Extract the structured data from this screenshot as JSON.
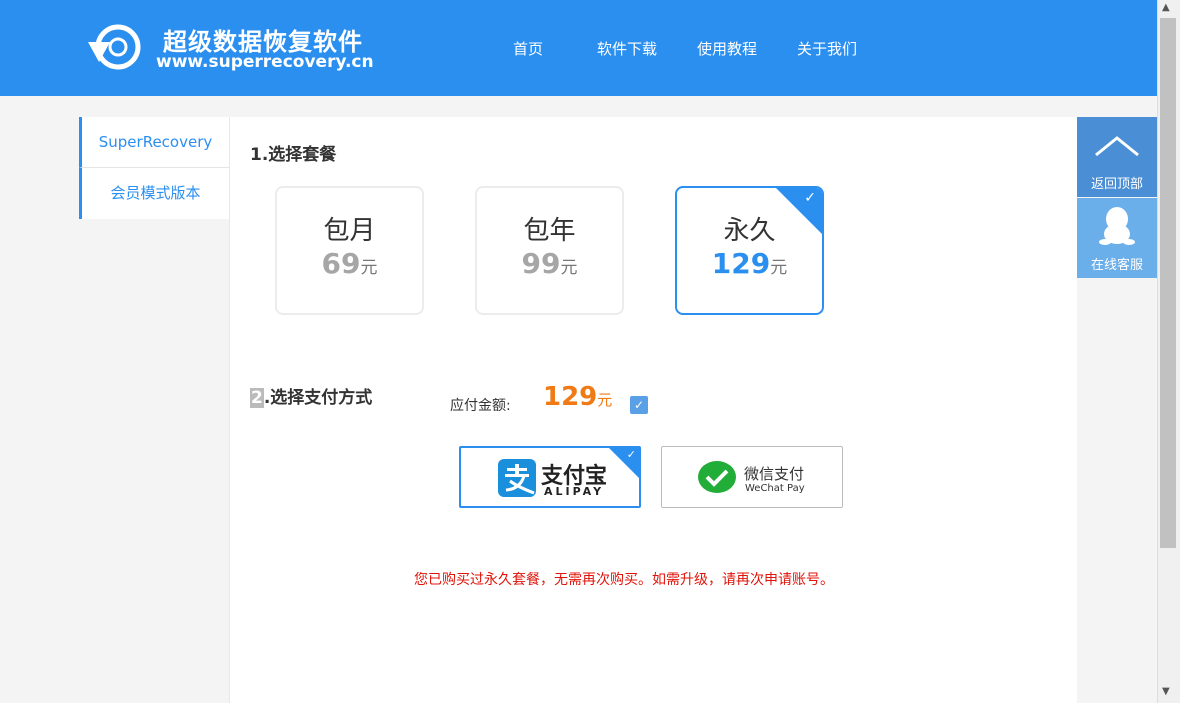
{
  "header": {
    "title": "超级数据恢复软件",
    "url": "www.superrecovery.cn",
    "nav": [
      "首页",
      "软件下载",
      "使用教程",
      "关于我们"
    ]
  },
  "sidebar": {
    "items": [
      "SuperRecovery",
      "会员模式版本"
    ]
  },
  "section1": {
    "title": "1.选择套餐"
  },
  "plans": [
    {
      "name": "包月",
      "price": "69",
      "unit": "元",
      "selected": false
    },
    {
      "name": "包年",
      "price": "99",
      "unit": "元",
      "selected": false
    },
    {
      "name": "永久",
      "price": "129",
      "unit": "元",
      "selected": true
    }
  ],
  "section2": {
    "num": "2",
    "title": ".选择支付方式"
  },
  "amount": {
    "label": "应付金额:",
    "value": "129",
    "unit": "元",
    "checked": true
  },
  "payment": {
    "alipay": {
      "cn": "支付宝",
      "en": "ALIPAY",
      "selected": true
    },
    "wechat": {
      "cn": "微信支付",
      "en": "WeChat Pay",
      "selected": false
    }
  },
  "notice": "您已购买过永久套餐，无需再次购买。如需升级，请再次申请账号。",
  "tools": {
    "back_top": "返回顶部",
    "service": "在线客服"
  },
  "colors": {
    "brand": "#2b8ff0",
    "price": "#f07a15",
    "error": "#e0140a"
  }
}
